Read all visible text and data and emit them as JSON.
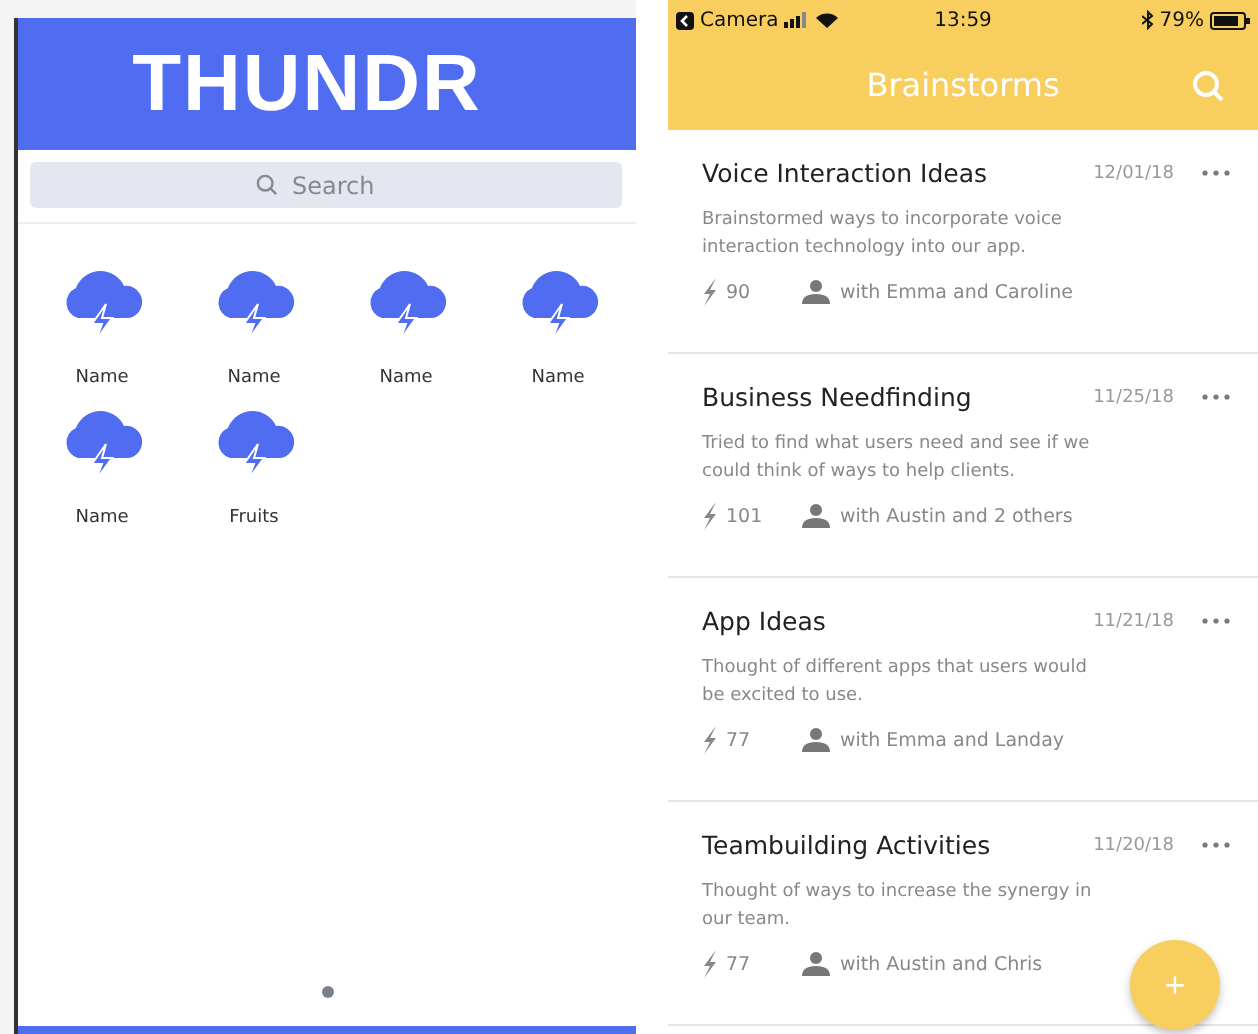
{
  "left_app": {
    "logo": "THUNDR",
    "search": {
      "placeholder": "Search"
    },
    "items": [
      {
        "label": "Name"
      },
      {
        "label": "Name"
      },
      {
        "label": "Name"
      },
      {
        "label": "Name"
      },
      {
        "label": "Name"
      },
      {
        "label": "Fruits"
      }
    ],
    "page_dots": [
      {
        "selected": true
      }
    ]
  },
  "right_app": {
    "status_bar": {
      "back_app": "Camera",
      "time": "13:59",
      "battery": "79%"
    },
    "title": "Brainstorms",
    "cards": [
      {
        "title": "Voice Interaction Ideas",
        "date": "12/01/18",
        "description": "Brainstormed ways to incorporate voice interaction technology into our app.",
        "count": "90",
        "people": "with Emma and Caroline"
      },
      {
        "title": "Business Needfinding",
        "date": "11/25/18",
        "description": "Tried to find what users need and see if we could think of ways to help clients.",
        "count": "101",
        "people": "with Austin and 2 others"
      },
      {
        "title": "App Ideas",
        "date": "11/21/18",
        "description": "Thought of different apps that users would be excited to use.",
        "count": "77",
        "people": "with Emma and Landay"
      },
      {
        "title": "Teambuilding Activities",
        "date": "11/20/18",
        "description": "Thought of ways to increase the synergy in our team.",
        "count": "77",
        "people": "with Austin and Chris"
      }
    ],
    "fab": "+"
  }
}
